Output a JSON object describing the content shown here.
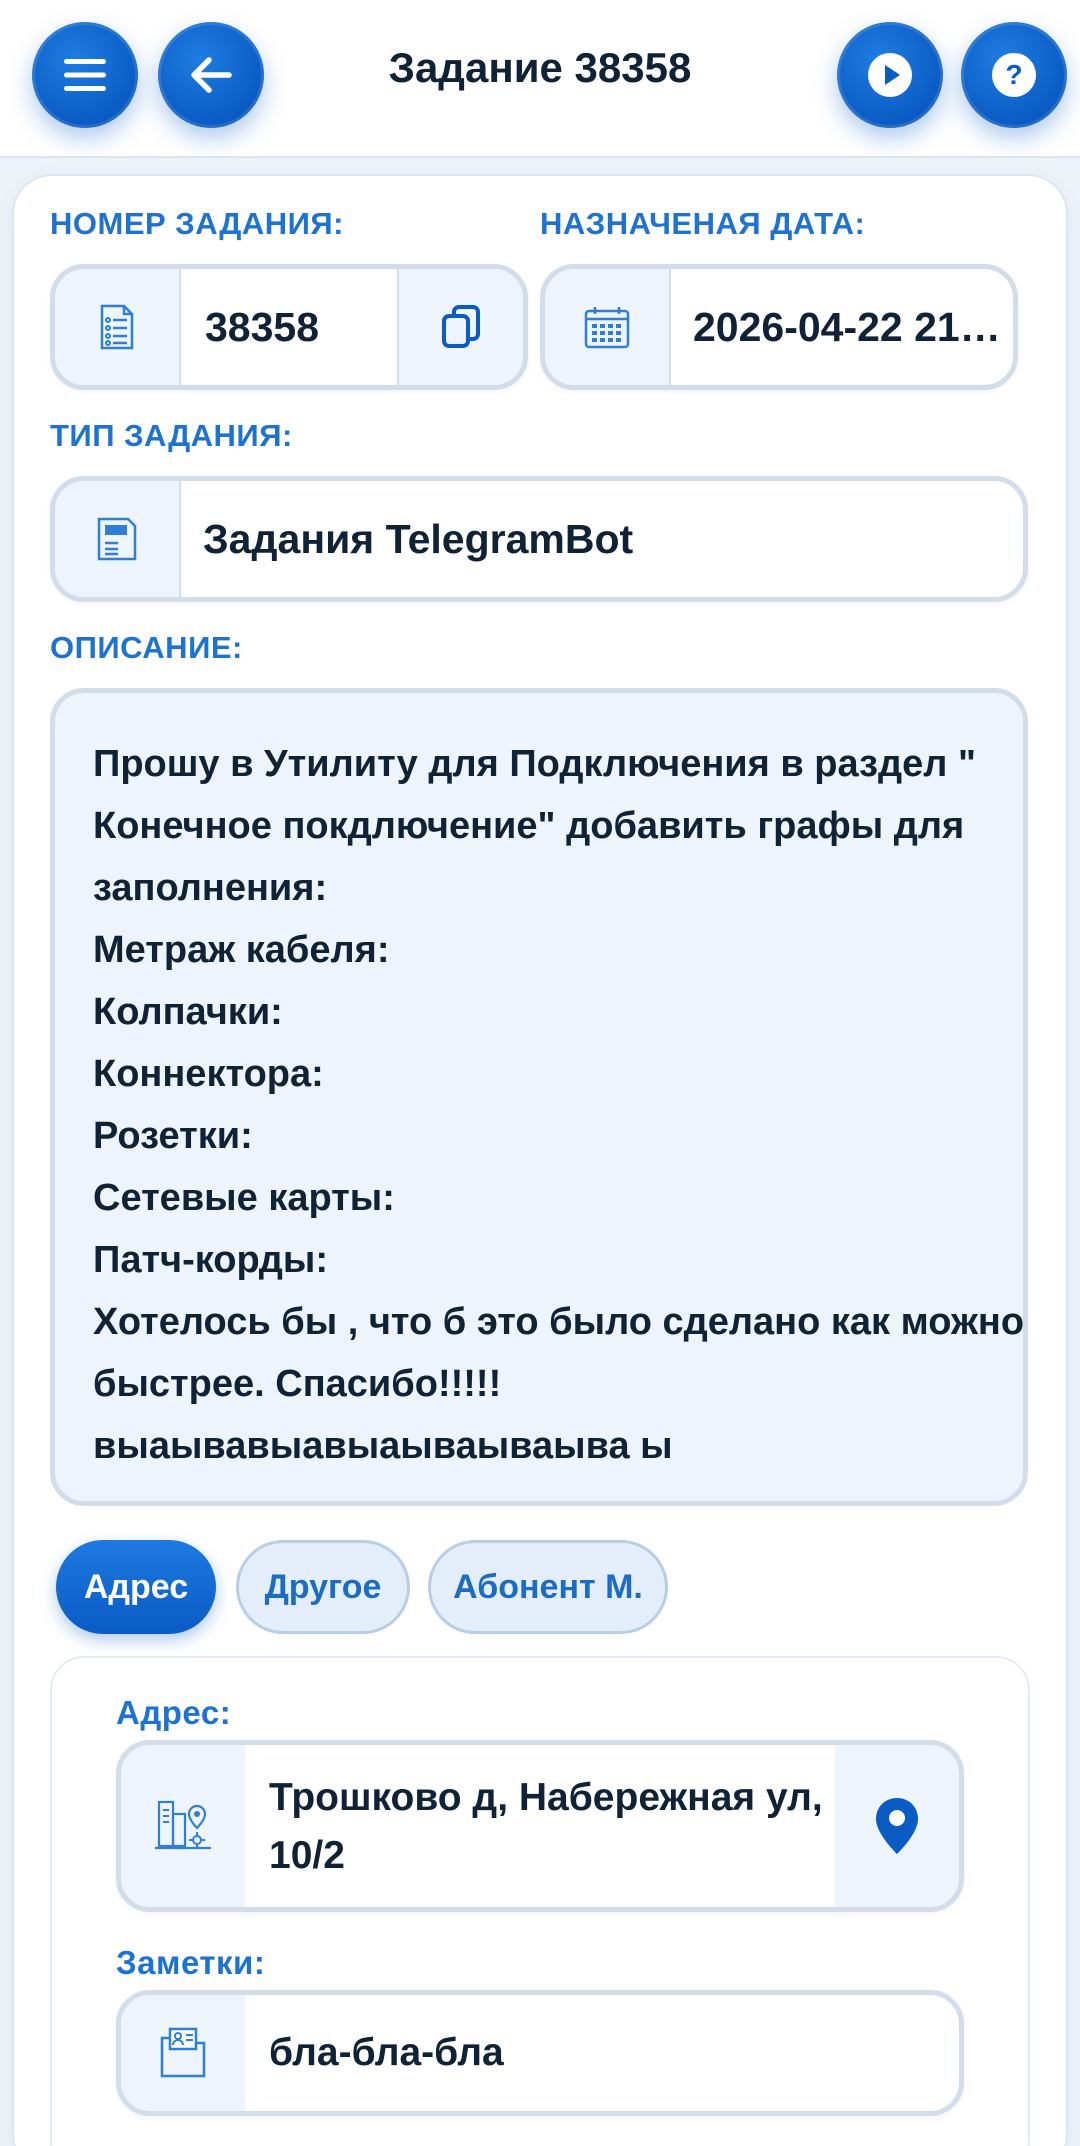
{
  "header": {
    "title": "Задание 38358",
    "menu_icon": "hamburger-icon",
    "back_icon": "arrow-left-icon",
    "play_icon": "play-icon",
    "help_icon": "question-icon"
  },
  "task_number": {
    "label": "НОМЕР ЗАДАНИЯ:",
    "value": "38358",
    "icon": "checklist-icon",
    "copy_icon": "copy-icon"
  },
  "assigned_date": {
    "label": "НАЗНАЧЕНАЯ ДАТА:",
    "value": "2026-04-22 21…",
    "icon": "calendar-icon"
  },
  "task_type": {
    "label": "ТИП ЗАДАНИЯ:",
    "value": "Задания TelegramBot",
    "icon": "document-icon"
  },
  "description": {
    "label": "ОПИСАНИЕ:",
    "lines": [
      "Прошу в Утилиту для Подключения в раздел \"",
      "Конечное покдлючение\" добавить графы для",
      "заполнения:",
      "Метраж кабеля:",
      "Колпачки:",
      "Коннектора:",
      "Розетки:",
      "Сетевые карты:",
      "Патч-корды:",
      "Хотелось бы , что б это было сделано как можно",
      "быстрее. Спасибо!!!!!",
      "выаывавыавыаываываыва ы"
    ]
  },
  "tabs": [
    {
      "label": "Адрес",
      "active": true
    },
    {
      "label": "Другое",
      "active": false
    },
    {
      "label": "Абонент М.",
      "active": false
    }
  ],
  "address": {
    "label": "Адрес:",
    "line1": "Трошково д, Набережная ул,",
    "line2": "10/2",
    "icon": "city-map-icon",
    "pin_icon": "map-pin-icon"
  },
  "notes": {
    "label": "Заметки:",
    "value": "бла-бла-бла",
    "icon": "folder-user-icon"
  },
  "colors": {
    "accent": "#0a5bc4",
    "label_blue": "#1d72d2",
    "field_border": "#d2dde9",
    "icon_cell_bg": "#eef4fb"
  }
}
